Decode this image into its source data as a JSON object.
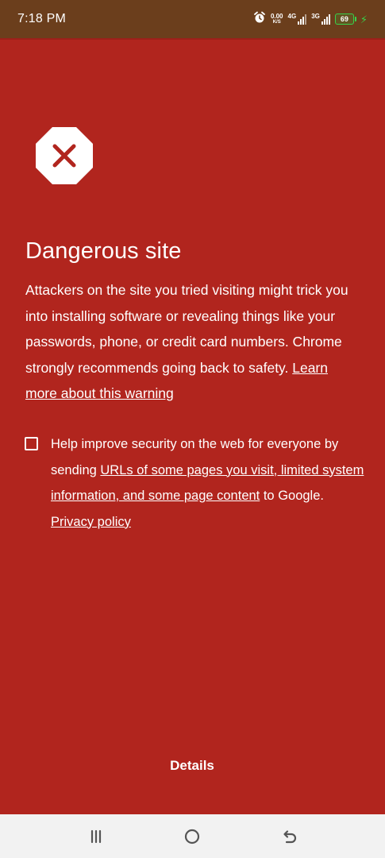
{
  "status_bar": {
    "time": "7:18 PM",
    "speed_value": "0.00",
    "speed_unit": "K/S",
    "network1": "4G",
    "network2": "3G",
    "battery": "69"
  },
  "warning": {
    "title": "Dangerous site",
    "body": "Attackers on the site you tried visiting might trick you into installing software or revealing things like your passwords, phone, or credit card numbers. Chrome strongly recommends going back to safety. ",
    "learn_more": "Learn more about this warning"
  },
  "report": {
    "text_before": "Help improve security on the web for everyone by sending ",
    "link": "URLs of some pages you visit, limited system information, and some page content",
    "text_after": " to Google. ",
    "privacy_link": "Privacy policy"
  },
  "details_label": "Details",
  "colors": {
    "background": "#b1251e",
    "status_bar": "#6b3e1c",
    "nav_bar": "#f2f2f2",
    "battery": "#37d24a"
  },
  "icons": {
    "danger": "stop-octagon-x-icon",
    "alarm": "alarm-clock-icon",
    "recent": "menu-lines-icon",
    "home": "home-circle-icon",
    "back": "back-arrow-icon"
  }
}
